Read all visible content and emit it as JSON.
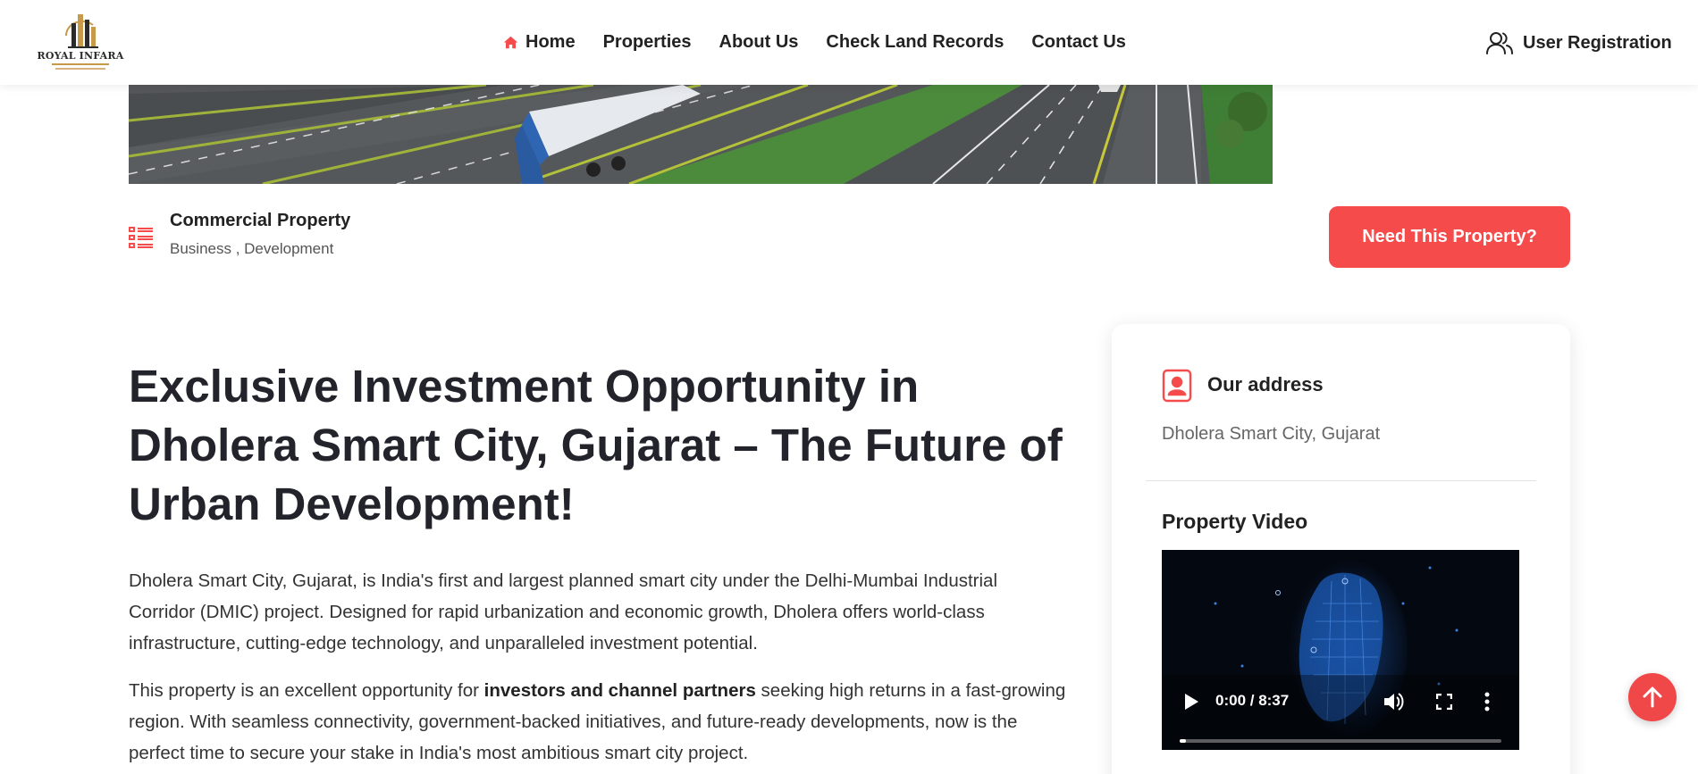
{
  "brand": {
    "name": "ROYAL INFARA",
    "logo_icon": "city-skyline-logo",
    "accent": "#f54b4b",
    "logo_gold": "#c79a4a"
  },
  "nav": {
    "items": [
      {
        "label": "Home",
        "icon": "home-icon",
        "active": true
      },
      {
        "label": "Properties"
      },
      {
        "label": "About Us"
      },
      {
        "label": "Check Land Records"
      },
      {
        "label": "Contact Us"
      }
    ],
    "user_registration": {
      "label": "User Registration",
      "icon": "user-group-icon"
    }
  },
  "property": {
    "type_icon": "list-icon",
    "type": "Commercial Property",
    "categories": "Business , Development",
    "cta_label": "Need This Property?",
    "headline": "Exclusive Investment Opportunity in Dholera Smart City, Gujarat – The Future of Urban Development!",
    "description_1": "Dholera Smart City, Gujarat, is India's first and largest planned smart city under the Delhi-Mumbai Industrial Corridor (DMIC) project. Designed for rapid urbanization and economic growth, Dholera offers world-class infrastructure, cutting-edge technology, and unparalleled investment potential.",
    "description_2_pre": "This property is an excellent opportunity for ",
    "description_2_bold": "investors and channel partners",
    "description_2_post": " seeking high returns in a fast-growing region. With seamless connectivity, government-backed initiatives, and future-ready developments, now is the perfect time to secure your stake in India's most ambitious smart city project."
  },
  "sidebar": {
    "address_icon": "contact-card-icon",
    "address_title": "Our address",
    "address_text": "Dholera Smart City, Gujarat",
    "video_title": "Property Video",
    "video": {
      "time": "0:00 / 8:37",
      "progress": 0.02,
      "controls": [
        "play-icon",
        "volume-icon",
        "fullscreen-icon",
        "more-options-icon"
      ]
    }
  },
  "scroll_top_icon": "arrow-up-icon"
}
